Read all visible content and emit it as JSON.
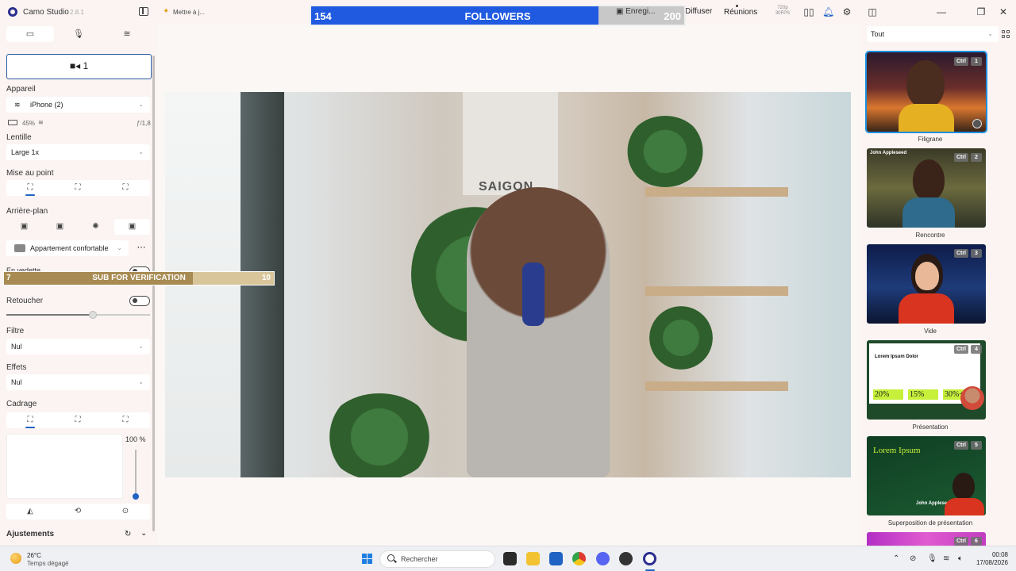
{
  "titlebar": {
    "app_name": "Camo Studio",
    "version": "2.8.1",
    "hint": "Mettre à j...",
    "record_label": "Enregi...",
    "broadcast_label": "Diffuser",
    "meetings_label": "Réunions",
    "resolution": "720p",
    "fps": "30FPS"
  },
  "followers_goal": {
    "current": "154",
    "label": "FOLLOWERS",
    "target": "200",
    "progress": 0.77,
    "fill_color": "#1f5ae0"
  },
  "sub_goal": {
    "current": "7",
    "label": "SUB FOR VERIFICATION",
    "target": "10",
    "progress": 0.7,
    "fill_color": "#a88b52"
  },
  "left_panel": {
    "tabs": [
      "video-icon",
      "microphone-icon",
      "layers-icon"
    ],
    "camera_button_label": "1",
    "device_label": "Appareil",
    "device_value": "iPhone (2)",
    "battery": "45%",
    "aperture": "ƒ/1,8",
    "lens_label": "Lentille",
    "lens_value": "Large 1x",
    "focus_label": "Mise au point",
    "background_label": "Arrière-plan",
    "background_value": "Appartement confortable",
    "featured_label": "En vedette",
    "retouch_label": "Retoucher",
    "retouch_level": 0.6,
    "filter_label": "Filtre",
    "filter_value": "Nul",
    "effects_label": "Effets",
    "effects_value": "Nul",
    "framing_label": "Cadrage",
    "zoom_value": "100 %",
    "adjustments_label": "Ajustements"
  },
  "preview": {
    "sign_text": "SAIGON"
  },
  "right_panel": {
    "filter_value": "Tout",
    "scenes": [
      {
        "label": "Filigrane",
        "ctrl": "Ctrl",
        "num": "1",
        "selected": true
      },
      {
        "label": "Rencontre",
        "ctrl": "Ctrl",
        "num": "2",
        "selected": false,
        "name_tag": "John Appleseed"
      },
      {
        "label": "Vide",
        "ctrl": "Ctrl",
        "num": "3",
        "selected": false
      },
      {
        "label": "Présentation",
        "ctrl": "Ctrl",
        "num": "4",
        "selected": false,
        "title": "Lorem Ipsum Dolor",
        "stats": [
          "20%",
          "15%",
          "30%+"
        ]
      },
      {
        "label": "Superposition de présentation",
        "ctrl": "Ctrl",
        "num": "5",
        "selected": false,
        "title": "Lorem Ipsum",
        "name_tag": "John Appleseed"
      },
      {
        "label": "",
        "ctrl": "Ctrl",
        "num": "6",
        "selected": false
      }
    ]
  },
  "taskbar": {
    "temperature": "26°C",
    "weather": "Temps dégagé",
    "search_placeholder": "Rechercher",
    "time": "00:08",
    "date": "17/08/2026"
  }
}
